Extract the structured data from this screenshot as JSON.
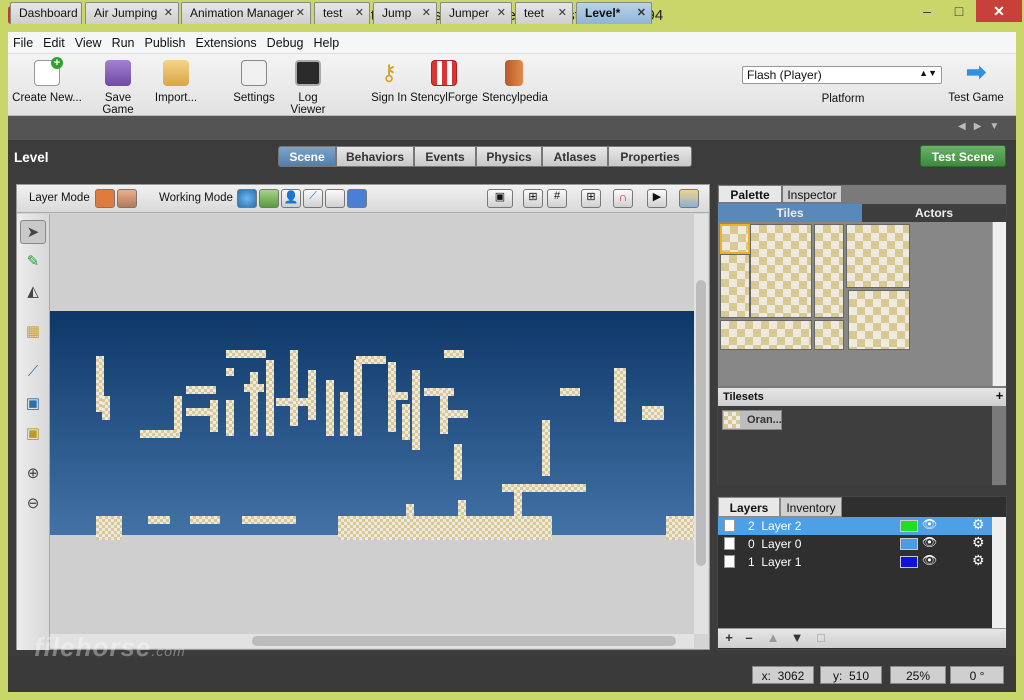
{
  "window": {
    "title": "Stencyl - Usitility Game Run Test - Build 7994",
    "icon_letter": "C",
    "minimize": "–",
    "maximize": "□",
    "close": "✕"
  },
  "menu": [
    "File",
    "Edit",
    "View",
    "Run",
    "Publish",
    "Extensions",
    "Debug",
    "Help"
  ],
  "toolbar": {
    "create_new": "Create New...",
    "save_game": "Save Game",
    "import": "Import...",
    "settings": "Settings",
    "log_viewer": "Log Viewer",
    "sign_in": "Sign In",
    "stencylforge": "StencylForge",
    "stencylpedia": "Stencylpedia",
    "platform_value": "Flash (Player)",
    "platform_label": "Platform",
    "test_game": "Test Game"
  },
  "tabs": [
    {
      "label": "Dashboard"
    },
    {
      "label": "Air Jumping"
    },
    {
      "label": "Animation Manager"
    },
    {
      "label": "test"
    },
    {
      "label": "Jump"
    },
    {
      "label": "Jumper"
    },
    {
      "label": "teet"
    },
    {
      "label": "Level*"
    }
  ],
  "tab_close": "✕",
  "level": {
    "title": "Level",
    "segments": [
      "Scene",
      "Behaviors",
      "Events",
      "Physics",
      "Atlases",
      "Properties"
    ],
    "active_segment": "Scene",
    "test_scene": "Test Scene"
  },
  "mode_bar": {
    "layer_mode": "Layer Mode",
    "working_mode": "Working Mode"
  },
  "palette": {
    "tabs": [
      "Palette",
      "Inspector"
    ],
    "subtabs": [
      "Tiles",
      "Actors"
    ],
    "tilesets_header": "Tilesets",
    "tileset_item": "Oran..."
  },
  "layers": {
    "tabs": [
      "Layers",
      "Inventory"
    ],
    "rows": [
      {
        "id": "2",
        "name": "Layer 2",
        "color": "#22dd22",
        "selected": true
      },
      {
        "id": "0",
        "name": "Layer 0",
        "color": "#4d9be0",
        "selected": false
      },
      {
        "id": "1",
        "name": "Layer 1",
        "color": "#1111dd",
        "selected": false
      }
    ]
  },
  "status": {
    "x_label": "x:",
    "x": "3062",
    "y_label": "y:",
    "y": "510",
    "zoom": "25%",
    "rotation": "0 °"
  },
  "watermark": {
    "text": "filehorse",
    "suffix": ".com"
  }
}
